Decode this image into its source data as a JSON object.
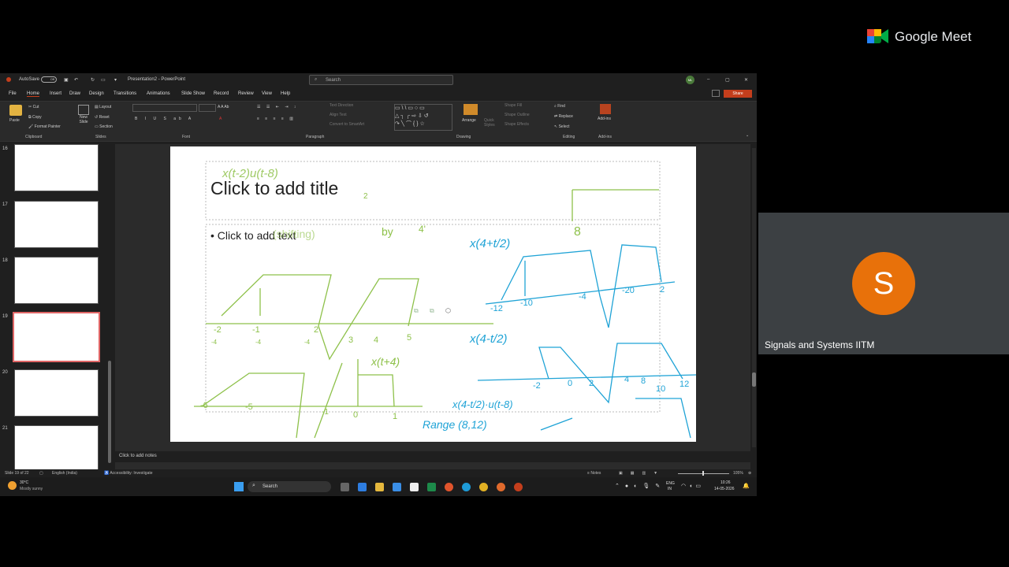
{
  "meet": {
    "brand": "Google Meet",
    "participant_initial": "S",
    "participant_name": "Signals and Systems IITM"
  },
  "ppt": {
    "autosave": "AutoSave",
    "autosave_state": "Off",
    "doc_title": "Presentation2 - PowerPoint",
    "search_placeholder": "Search",
    "user_initials": "ML",
    "share_label": "Share",
    "menu": [
      "File",
      "Home",
      "Insert",
      "Draw",
      "Design",
      "Transitions",
      "Animations",
      "Slide Show",
      "Record",
      "Review",
      "View",
      "Help"
    ],
    "ribbon": {
      "clipboard": {
        "paste": "Paste",
        "cut": "Cut",
        "copy": "Copy",
        "format_painter": "Format Painter",
        "label": "Clipboard"
      },
      "slides": {
        "new_slide": "New Slide",
        "layout": "Layout",
        "reset": "Reset",
        "section": "Section",
        "label": "Slides"
      },
      "font_label": "Font",
      "paragraph": {
        "text_direction": "Text Direction",
        "align_text": "Align Text",
        "smartart": "Convert to SmartArt",
        "label": "Paragraph"
      },
      "drawing": {
        "arrange": "Arrange",
        "quick_styles": "Quick Styles",
        "shape_fill": "Shape Fill",
        "shape_outline": "Shape Outline",
        "shape_effects": "Shape Effects",
        "label": "Drawing"
      },
      "editing": {
        "find": "Find",
        "replace": "Replace",
        "select": "Select",
        "label": "Editing"
      },
      "addins": {
        "addins": "Add-ins",
        "label": "Add-ins"
      }
    },
    "thumb_numbers": [
      "16",
      "17",
      "18",
      "19",
      "20",
      "21"
    ],
    "slide": {
      "title_placeholder": "Click to add title",
      "body_placeholder": "Click to add text"
    },
    "notes_placeholder": "Click to add notes",
    "status": {
      "slide_count": "Slide 19 of 22",
      "language": "English (India)",
      "accessibility": "Accessibility: Investigate",
      "notes": "Notes",
      "zoom": "105%"
    },
    "taskbar": {
      "temp": "30°C",
      "weather": "Mostly sunny",
      "search": "Search",
      "lang1": "ENG",
      "lang2": "IN",
      "time": "10:26",
      "date": "14-05-2026"
    }
  },
  "ink": {
    "green": [
      "x(t-2)u(t-8)",
      "2",
      "(shifting)",
      "by",
      "4'",
      "8",
      "-2",
      "-1",
      "2",
      "3",
      "4",
      "5",
      "-4",
      "-4",
      "-4",
      "x(t+4)",
      "-6",
      "-5",
      "0",
      "1",
      "-1"
    ],
    "blue": [
      "x(4+t/2)",
      "-12",
      "-10",
      "-4",
      "-20",
      "2",
      "x(4-t/2)",
      "-2",
      "0",
      "2",
      "4",
      "8",
      "10",
      "12",
      "x(4-t/2)·u(t-8)",
      "Range (8,12)"
    ]
  },
  "colors": {
    "accent_red": "#c43e1c",
    "meet_orange": "#e8710a",
    "ink_green": "#8ec14a",
    "ink_blue": "#1fa3d6"
  }
}
